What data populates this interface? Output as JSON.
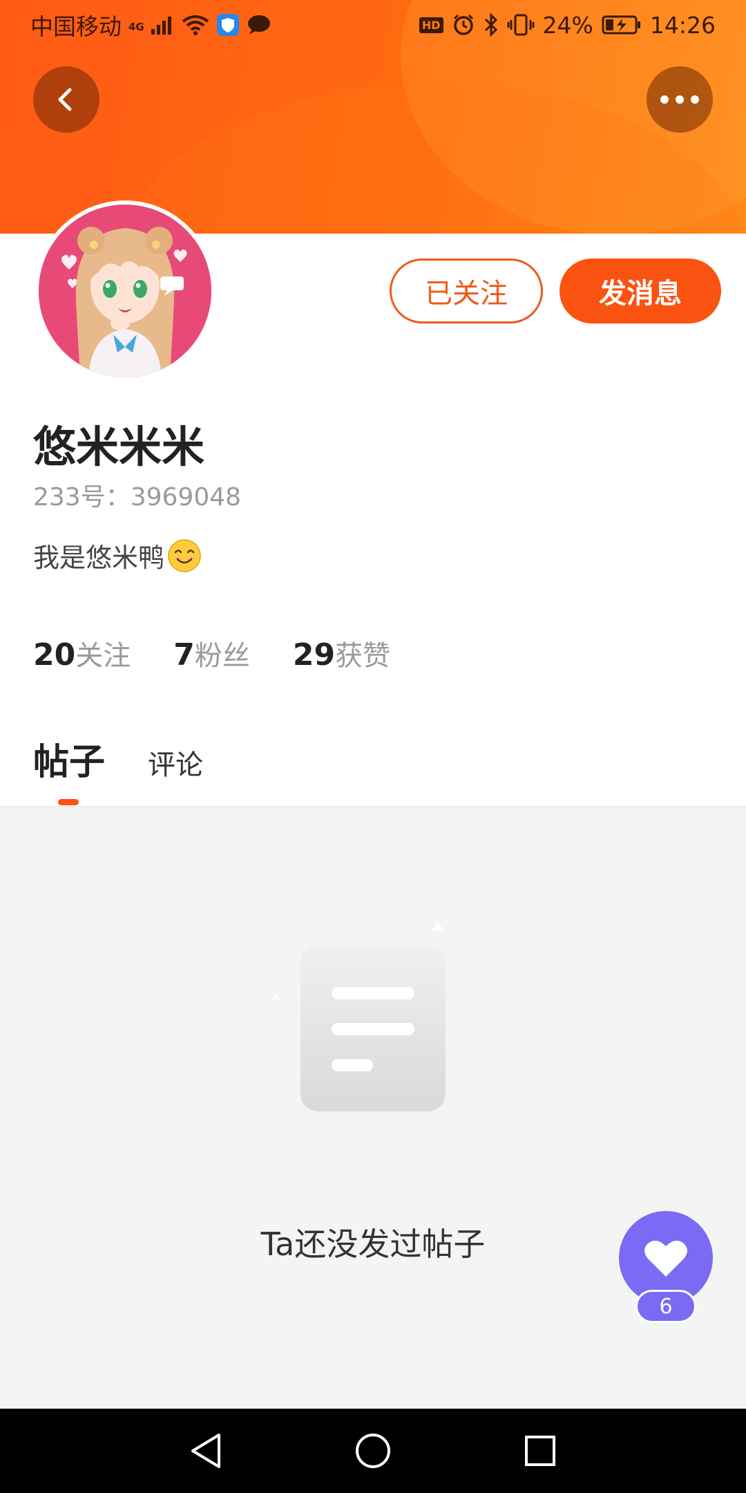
{
  "status_bar": {
    "carrier": "中国移动",
    "network": "4G",
    "hd": "HD",
    "battery_percent": "24%",
    "time": "14:26"
  },
  "actions": {
    "following_label": "已关注",
    "message_label": "发消息"
  },
  "profile": {
    "username": "悠米米米",
    "id_text": "233号：3969048",
    "bio": "我是悠米鸭",
    "bio_emoji": "smiling-face-emoji"
  },
  "stats": [
    {
      "value": "20",
      "label": "关注"
    },
    {
      "value": "7",
      "label": "粉丝"
    },
    {
      "value": "29",
      "label": "获赞"
    }
  ],
  "tabs": [
    {
      "label": "帖子",
      "active": true
    },
    {
      "label": "评论",
      "active": false
    }
  ],
  "empty_state": {
    "text": "Ta还没发过帖子",
    "icon": "document-icon"
  },
  "like_fab": {
    "count": "6",
    "icon": "heart-icon"
  },
  "colors": {
    "accent": "#fa5210",
    "header_start": "#ff5a16",
    "header_end": "#ff8a1a",
    "fab": "#7a6af4"
  },
  "icons": [
    "back-icon",
    "more-icon",
    "back-triangle-icon",
    "home-circle-icon",
    "recents-square-icon"
  ]
}
